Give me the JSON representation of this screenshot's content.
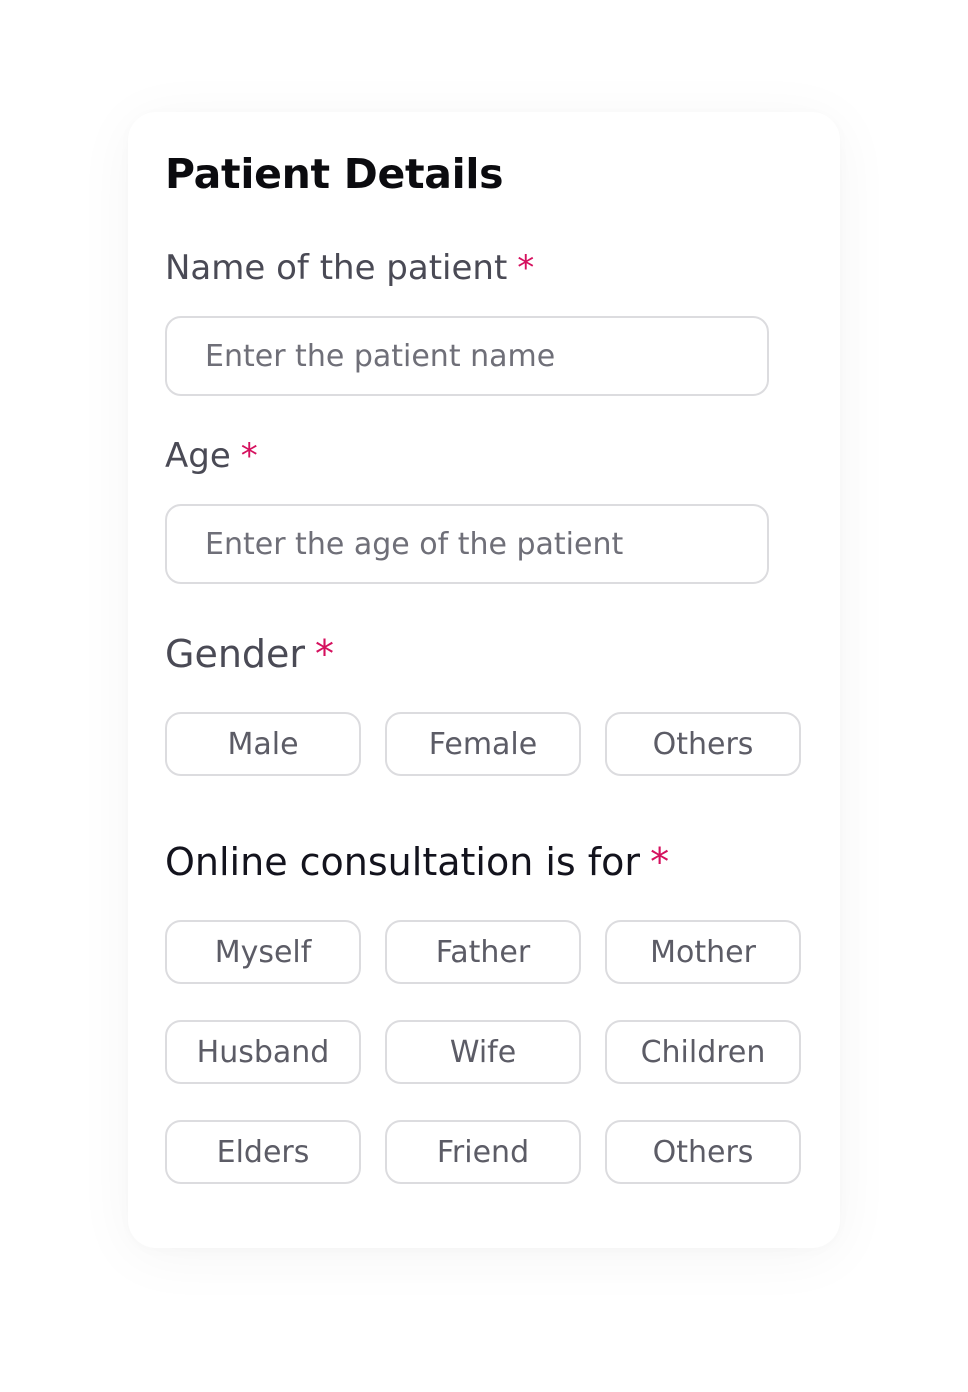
{
  "form": {
    "title": "Patient Details",
    "required_marker": "*",
    "name": {
      "label": "Name of the patient",
      "placeholder": "Enter the patient name",
      "value": ""
    },
    "age": {
      "label": "Age",
      "placeholder": "Enter the age of the patient",
      "value": ""
    },
    "gender": {
      "label": "Gender",
      "options": [
        "Male",
        "Female",
        "Others"
      ]
    },
    "consultation": {
      "label": "Online consultation is for",
      "options": [
        "Myself",
        "Father",
        "Mother",
        "Husband",
        "Wife",
        "Children",
        "Elders",
        "Friend",
        "Others"
      ]
    }
  },
  "colors": {
    "required": "#d5105e",
    "border": "#dcdcdf",
    "title": "#0b0b0f",
    "label": "#4a4a55"
  }
}
